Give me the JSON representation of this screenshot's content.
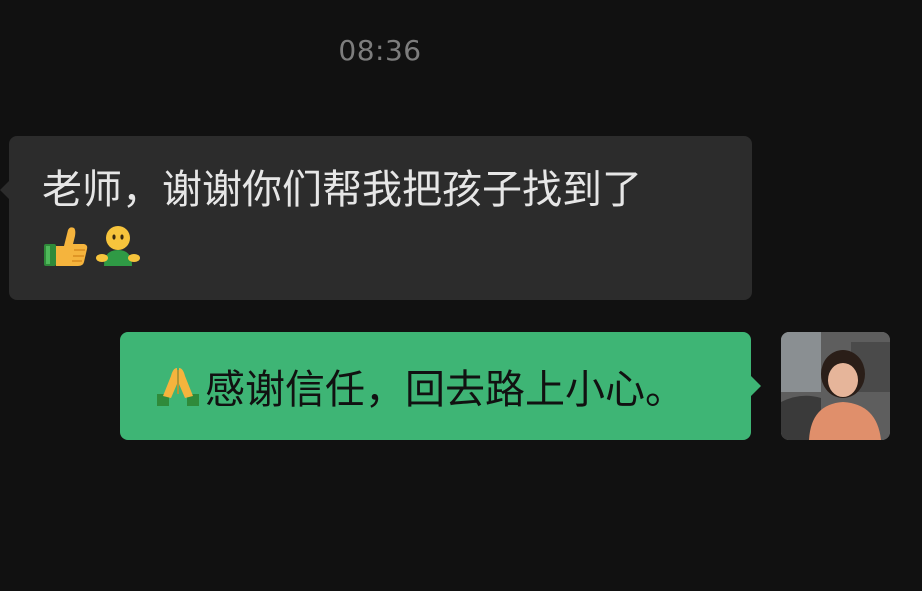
{
  "chat": {
    "timestamp": "08:36",
    "messages": [
      {
        "direction": "incoming",
        "text": "老师，谢谢你们帮我把孩子找到了",
        "emojis": [
          "thumbs-up-emoji",
          "hugging-figure-emoji"
        ]
      },
      {
        "direction": "outgoing",
        "emoji": "folded-hands-emoji",
        "text": "感谢信任，回去路上小心。"
      }
    ]
  },
  "colors": {
    "background": "#111111",
    "incoming_bubble": "#2c2c2c",
    "outgoing_bubble": "#3eb575",
    "timestamp_text": "#7d7d7d"
  }
}
